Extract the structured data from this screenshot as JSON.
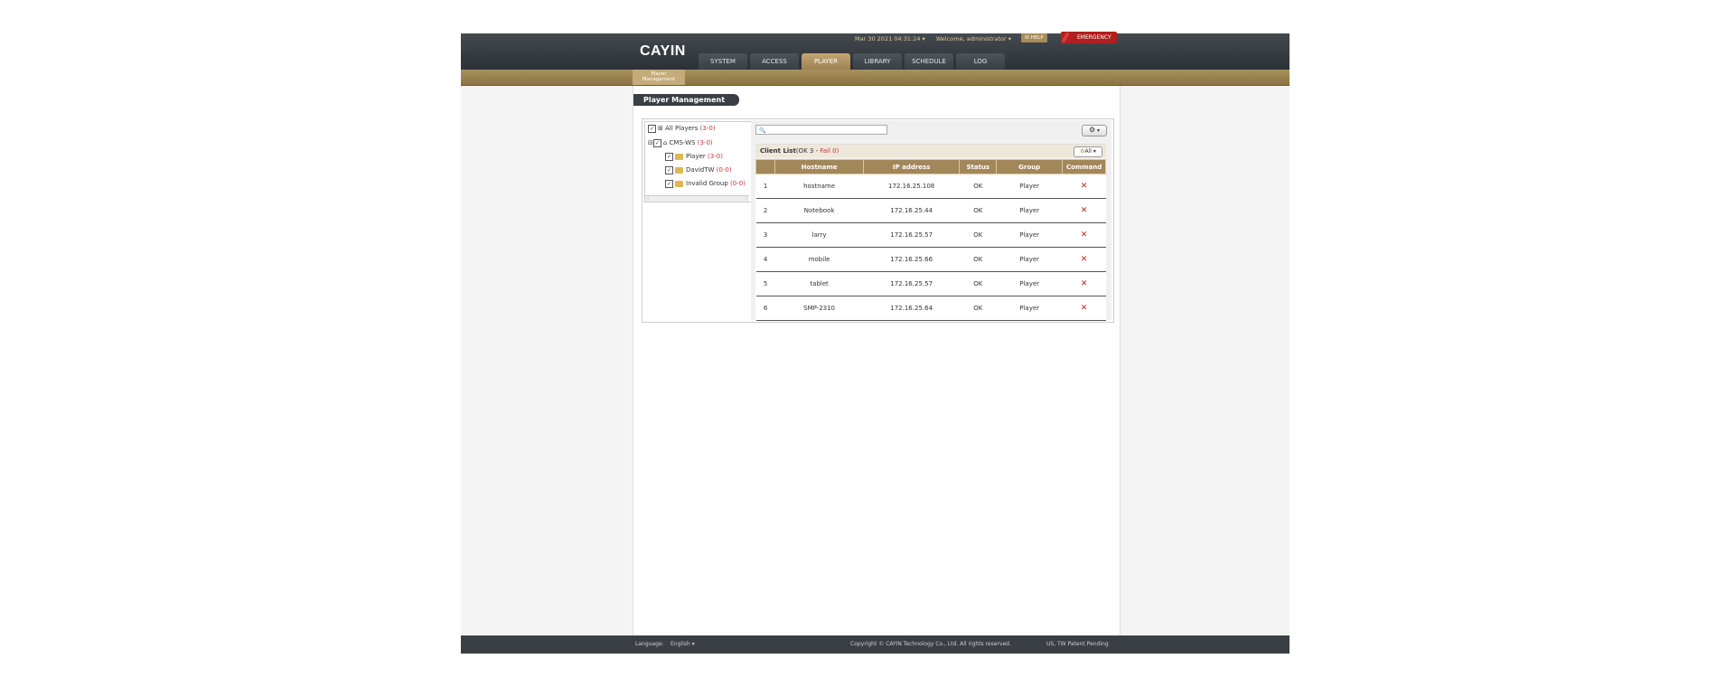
{
  "header": {
    "datetime": "Mar 30 2021 04:31:24 ▾",
    "welcome": "Welcome, administrator ▾",
    "help": "HELP",
    "emergency": "EMERGENCY",
    "logo": "CAYIN"
  },
  "nav": {
    "tabs": [
      {
        "label": "SYSTEM"
      },
      {
        "label": "ACCESS"
      },
      {
        "label": "PLAYER"
      },
      {
        "label": "LIBRARY"
      },
      {
        "label": "SCHEDULE"
      },
      {
        "label": "LOG"
      }
    ],
    "active": "PLAYER",
    "subtab_line1": "Player",
    "subtab_line2": "Management"
  },
  "page": {
    "title": "Player Management"
  },
  "tree": {
    "root": {
      "label": "All Players",
      "count": "(3-0)"
    },
    "server": {
      "label": "CMS-WS",
      "count": "(3-0)"
    },
    "groups": [
      {
        "label": "Player",
        "count": "(3-0)"
      },
      {
        "label": "DavidTW",
        "count": "(0-0)"
      },
      {
        "label": "Invalid Group",
        "count": "(0-0)"
      }
    ]
  },
  "search": {
    "placeholder": "🔍"
  },
  "list": {
    "title": "Client List",
    "ok_text": "(OK 3 - ",
    "fail_text": "Fail 0)",
    "filter_label": "All ▾",
    "columns": [
      "",
      "Hostname",
      "IP address",
      "Status",
      "Group",
      "Command"
    ],
    "rows": [
      {
        "no": "1",
        "hostname": "hostname",
        "ip": "172.16.25.108",
        "status": "OK",
        "group": "Player"
      },
      {
        "no": "2",
        "hostname": "Notebook",
        "ip": "172.16.25.44",
        "status": "OK",
        "group": "Player"
      },
      {
        "no": "3",
        "hostname": "larry",
        "ip": "172.16.25.57",
        "status": "OK",
        "group": "Player"
      },
      {
        "no": "4",
        "hostname": "mobile",
        "ip": "172.16.25.66",
        "status": "OK",
        "group": "Player"
      },
      {
        "no": "5",
        "hostname": "tablet",
        "ip": "172.16.25.57",
        "status": "OK",
        "group": "Player"
      },
      {
        "no": "6",
        "hostname": "SMP-2310",
        "ip": "172.16.25.64",
        "status": "OK",
        "group": "Player"
      }
    ],
    "delete_glyph": "✕"
  },
  "footer": {
    "language_label": "Language:",
    "language_value": "English ▾",
    "copyright": "Copyright © CAYIN Technology Co., Ltd. All rights reserved.",
    "patent": "US, TW Patent Pending"
  },
  "colors": {
    "accent": "#a2875a",
    "topbar": "#2c3136",
    "emergency": "#b11f1f"
  }
}
